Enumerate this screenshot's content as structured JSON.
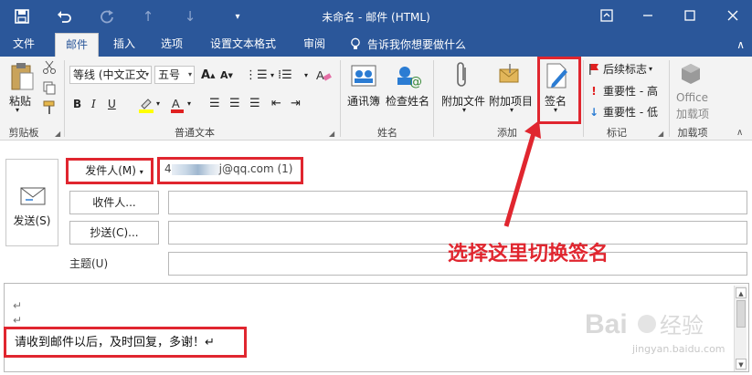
{
  "window": {
    "title": "未命名 - 邮件 (HTML)"
  },
  "tabs": [
    {
      "label": "文件"
    },
    {
      "label": "邮件"
    },
    {
      "label": "插入"
    },
    {
      "label": "选项"
    },
    {
      "label": "设置文本格式"
    },
    {
      "label": "审阅"
    }
  ],
  "tell_me": "告诉我你想要做什么",
  "ribbon": {
    "clipboard": {
      "paste": "粘贴",
      "group": "剪贴板"
    },
    "basic_text": {
      "font_name": "等线 (中文正文",
      "font_size": "五号",
      "group": "普通文本"
    },
    "names": {
      "address_book": "通讯簿",
      "check_names": "检查姓名",
      "group": "姓名"
    },
    "include": {
      "attach_file": "附加文件",
      "attach_item": "附加项目",
      "signature": "签名",
      "group": "添加"
    },
    "tags": {
      "follow_up": "后续标志",
      "high_importance": "重要性 - 高",
      "low_importance": "重要性 - 低",
      "group": "标记"
    },
    "addins": {
      "office_addins_line1": "Office",
      "office_addins_line2": "加载项",
      "group": "加载项"
    }
  },
  "compose": {
    "send": "发送(S)",
    "from_button": "发件人(M)",
    "from_value_suffix": "j@qq.com (1)",
    "from_value_prefix": "4",
    "to_button": "收件人...",
    "cc_button": "抄送(C)...",
    "subject_label": "主题(U)",
    "para_mark": "↵",
    "body_text": "请收到邮件以后，及时回复，多谢！↵"
  },
  "annotation": "选择这里切换签名",
  "watermark": {
    "brand": "Bai",
    "brand2": "经验",
    "url": "jingyan.baidu.com"
  },
  "colors": {
    "accent": "#2b579a",
    "annotation": "#e0262f"
  }
}
